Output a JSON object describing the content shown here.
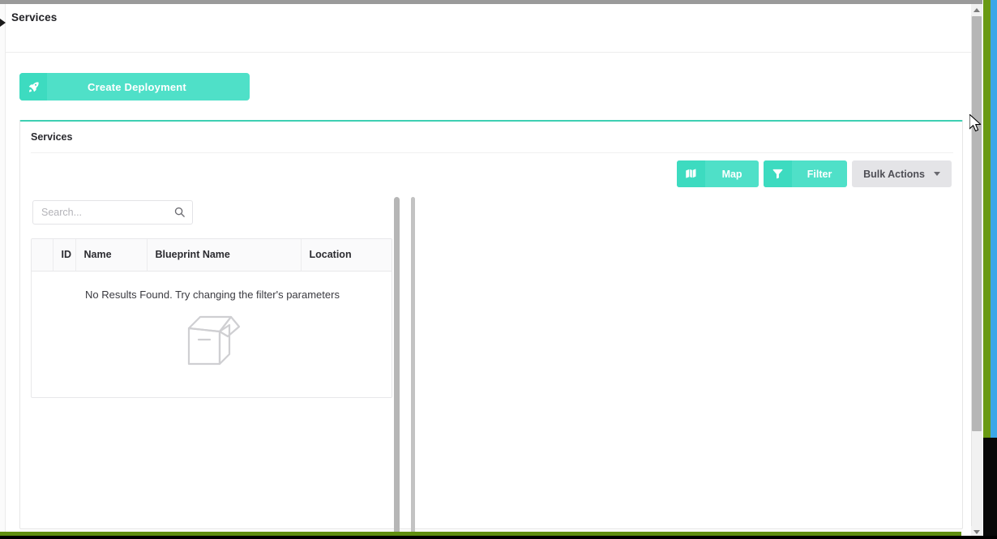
{
  "breadcrumb": {
    "caret_icon": "caret-right-icon",
    "title": "Services"
  },
  "actions": {
    "create_deployment": {
      "label": "Create Deployment",
      "icon": "rocket-icon"
    }
  },
  "panel": {
    "title": "Services",
    "toolbar": [
      {
        "label": "Map",
        "icon": "map-icon",
        "style": "teal"
      },
      {
        "label": "Filter",
        "icon": "funnel-icon",
        "style": "teal"
      },
      {
        "label": "Bulk Actions",
        "icon": "chevron-down-icon",
        "style": "gray"
      }
    ]
  },
  "search": {
    "placeholder": "Search...",
    "value": "",
    "icon": "search-icon"
  },
  "table": {
    "columns": [
      "",
      "ID",
      "Name",
      "Blueprint Name",
      "Location"
    ],
    "rows": [],
    "empty_state": {
      "message": "No Results Found. Try changing the filter's parameters",
      "icon": "empty-box-icon"
    }
  },
  "colors": {
    "accent_teal": "#4fe0c8",
    "accent_teal_dark": "#3ddbc0",
    "panel_top_border": "#3ecfb2",
    "gray_button": "#e4e4e7",
    "text_dark": "#2b2b30",
    "strip_green": "#6a9a13",
    "strip_blue": "#3aa7e8"
  }
}
